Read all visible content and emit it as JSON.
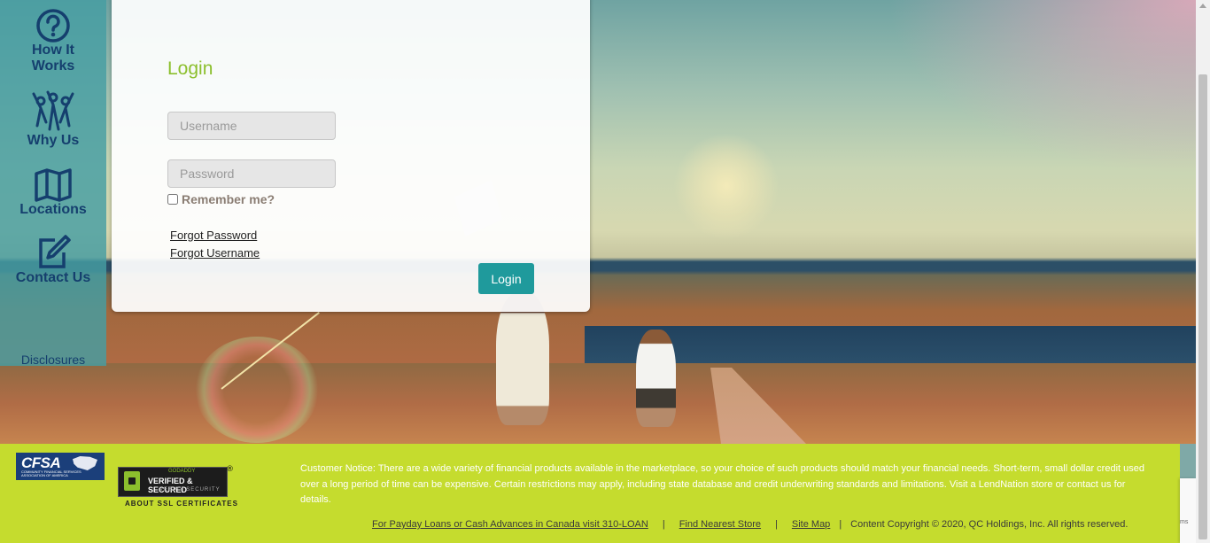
{
  "nav": {
    "items": [
      {
        "label_line1": "How It",
        "label_line2": "Works"
      },
      {
        "label_line1": "Why Us"
      },
      {
        "label_line1": "Locations"
      },
      {
        "label_line1": "Contact Us"
      }
    ],
    "disclosures": "Disclosures"
  },
  "login": {
    "title": "Login",
    "username_placeholder": "Username",
    "password_placeholder": "Password",
    "remember_label": "Remember me?",
    "forgot_password": "Forgot  Password",
    "forgot_username": "Forgot Username",
    "submit_label": "Login"
  },
  "footer": {
    "cfsa": {
      "name": "CFSA",
      "subtitle": "COMMUNITY FINANCIAL SERVICES ASSOCIATION OF AMERICA"
    },
    "ssl": {
      "brand": "GODADDY",
      "main": "VERIFIED & SECURED",
      "sub": "VERIFY SECURITY",
      "about": "ABOUT SSL CERTIFICATES",
      "reg": "®"
    },
    "notice": "Customer  Notice: There are a wide variety of financial products available in the marketplace, so your choice of such products should match your financial needs. Short-term, small dollar credit used over a long period of time can be expensive. Certain restrictions may apply, including state database and credit underwriting standards and limitations. Visit a  LendNation store or contact us for details.",
    "links": {
      "canada": "For  Payday  Loans or Cash Advances in Canada visit 310-LOAN",
      "find_store": "Find  Nearest Store",
      "site_map": "Site  Map",
      "separator": "|",
      "copyright": "Content Copyright © 2020, QC Holdings,  Inc. All rights reserved."
    }
  },
  "recaptcha_text": "ms",
  "colors": {
    "nav_bg": "#459ea2",
    "nav_text": "#153f6e",
    "login_title": "#8cbf2d",
    "login_button": "#1f9a9c",
    "footer_bg": "#c5dc2e"
  }
}
